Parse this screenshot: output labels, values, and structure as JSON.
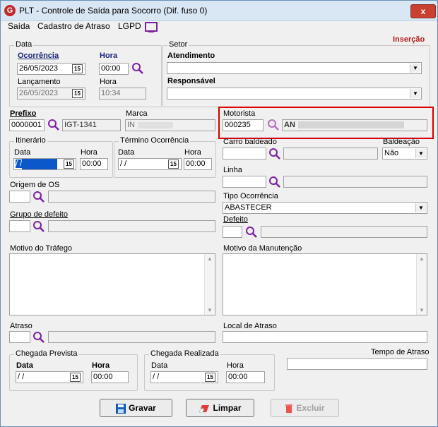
{
  "window": {
    "title": "PLT - Controle de Saída para Socorro (Dif. fuso 0)",
    "close_glyph": "x"
  },
  "menu": {
    "saida": "Saída",
    "cadastro_atraso": "Cadastro de Atraso",
    "lgpd": "LGPD"
  },
  "mode": "Inserção",
  "data_group": {
    "title": "Data",
    "ocorrencia_label": "Ocorrência",
    "ocorrencia_value": "26/05/2023",
    "hora_label": "Hora",
    "hora_value": "00:00",
    "lancamento_label": "Lançamento",
    "lancamento_value": "26/05/2023",
    "hora2_label": "Hora",
    "hora2_value": "10:34"
  },
  "setor": {
    "title": "Setor",
    "atendimento_label": "Atendimento",
    "atendimento_value": "",
    "responsavel_label": "Responsável",
    "responsavel_value": ""
  },
  "prefixo": {
    "label": "Prefixo",
    "value": "0000001",
    "code": "IGT-1341"
  },
  "marca": {
    "label": "Marca",
    "value": "IN"
  },
  "motorista": {
    "label": "Motorista",
    "value": "000235",
    "name": "AN"
  },
  "itinerario": {
    "title": "Itinerário",
    "data_label": "Data",
    "data_value": "/ /",
    "hora_label": "Hora",
    "hora_value": "00:00"
  },
  "termino": {
    "title": "Término Ocorrência",
    "data_label": "Data",
    "data_value": "/ /",
    "hora_label": "Hora",
    "hora_value": "00:00"
  },
  "carro": {
    "label": "Carro baldeado",
    "value": ""
  },
  "baldeacao": {
    "label": "Baldeação",
    "value": "Não"
  },
  "linha": {
    "label": "Linha"
  },
  "origem_os": {
    "label": "Origem de OS"
  },
  "grupo_defeito": {
    "label": "Grupo de defeito"
  },
  "tipo_ocorrencia": {
    "label": "Tipo Ocorrência",
    "value": "ABASTECER"
  },
  "defeito": {
    "label": "Defeito"
  },
  "motivo_trafego": {
    "label": "Motivo do Tráfego"
  },
  "motivo_manutencao": {
    "label": "Motivo da Manutenção"
  },
  "atraso": {
    "label": "Atraso"
  },
  "local_atraso": {
    "label": "Local de Atraso"
  },
  "chegada_prevista": {
    "title": "Chegada Prevista",
    "data_label": "Data",
    "data_value": "/ /",
    "hora_label": "Hora",
    "hora_value": "00:00"
  },
  "chegada_realizada": {
    "title": "Chegada Realizada",
    "data_label": "Data",
    "data_value": "/ /",
    "hora_label": "Hora",
    "hora_value": "00:00"
  },
  "tempo_atraso": {
    "label": "Tempo de Atraso",
    "value": ""
  },
  "buttons": {
    "gravar": "Gravar",
    "limpar": "Limpar",
    "excluir": "Excluir"
  },
  "calendar_glyph": "15",
  "colors": {
    "accent_red": "#d80000",
    "search_icon": "#7b1fa2",
    "mode_text": "#b71c1c",
    "selection": "#0a58ca"
  }
}
